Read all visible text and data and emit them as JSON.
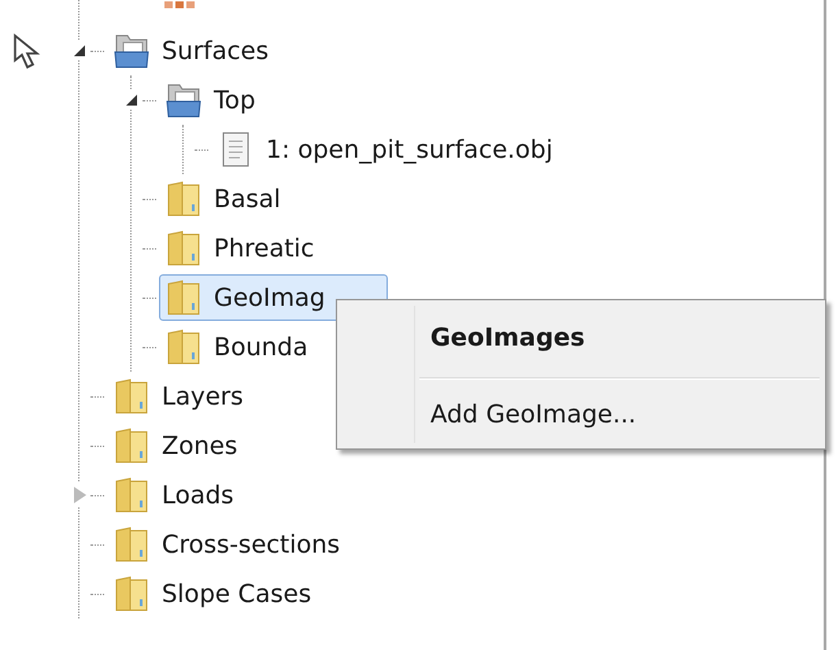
{
  "tree": [
    {
      "label": "Surfaces",
      "kind": "collection",
      "expanded": true,
      "selected": false,
      "children": [
        {
          "label": "Top",
          "kind": "collection",
          "expanded": true,
          "selected": false,
          "children": [
            {
              "label": "1: open_pit_surface.obj",
              "kind": "file",
              "selected": false
            }
          ]
        },
        {
          "label": "Basal",
          "kind": "folder",
          "selected": false
        },
        {
          "label": "Phreatic",
          "kind": "folder",
          "selected": false
        },
        {
          "label": "GeoImag",
          "kind": "folder",
          "selected": true
        },
        {
          "label": "Bounda",
          "kind": "folder",
          "selected": false
        }
      ]
    },
    {
      "label": "Layers",
      "kind": "folder",
      "selected": false
    },
    {
      "label": "Zones",
      "kind": "folder",
      "selected": false
    },
    {
      "label": "Loads",
      "kind": "folder",
      "expanded": false,
      "selected": false
    },
    {
      "label": "Cross-sections",
      "kind": "folder",
      "selected": false
    },
    {
      "label": "Slope Cases",
      "kind": "folder",
      "selected": false
    }
  ],
  "context_menu": {
    "items": [
      {
        "kind": "header",
        "label": "GeoImages"
      },
      {
        "kind": "command",
        "label": "Add GeoImage..."
      }
    ]
  }
}
